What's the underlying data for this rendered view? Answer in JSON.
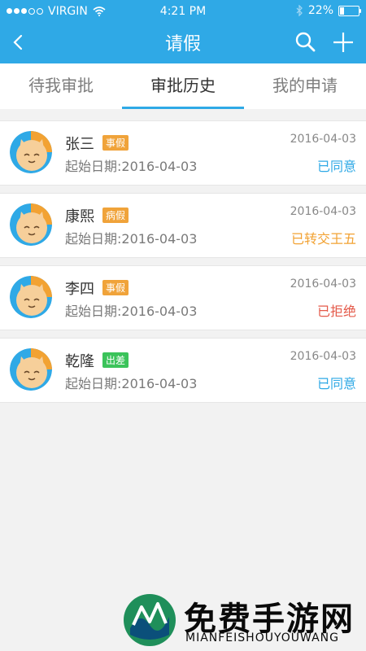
{
  "status_bar": {
    "carrier": "VIRGIN",
    "time": "4:21 PM",
    "battery": "22%",
    "battery_level": 0.22
  },
  "nav": {
    "title": "请假",
    "icons": [
      "back-icon",
      "search-icon",
      "add-icon"
    ]
  },
  "tabs": [
    {
      "label": "待我审批",
      "active": false
    },
    {
      "label": "审批历史",
      "active": true
    },
    {
      "label": "我的申请",
      "active": false
    }
  ],
  "records": [
    {
      "name": "张三",
      "tag": "事假",
      "tag_color": "#f0a33a",
      "subtitle_label": "起始日期:",
      "start_date": "2016-04-03",
      "date": "2016-04-03",
      "status": "已同意",
      "status_color": "#2fa9e6"
    },
    {
      "name": "康熙",
      "tag": "病假",
      "tag_color": "#f0a33a",
      "subtitle_label": "起始日期:",
      "start_date": "2016-04-03",
      "date": "2016-04-03",
      "status": "已转交王五",
      "status_color": "#f2a233"
    },
    {
      "name": "李四",
      "tag": "事假",
      "tag_color": "#f0a33a",
      "subtitle_label": "起始日期:",
      "start_date": "2016-04-03",
      "date": "2016-04-03",
      "status": "已拒绝",
      "status_color": "#e45a4a"
    },
    {
      "name": "乾隆",
      "tag": "出差",
      "tag_color": "#3bc35a",
      "subtitle_label": "起始日期:",
      "start_date": "2016-04-03",
      "date": "2016-04-03",
      "status": "已同意",
      "status_color": "#2fa9e6"
    }
  ],
  "watermark": {
    "title": "免费手游网",
    "subtitle": "MIANFEISHOUYOUWANG"
  },
  "colors": {
    "accent": "#2fa9e6",
    "background": "#f2f2f2"
  }
}
